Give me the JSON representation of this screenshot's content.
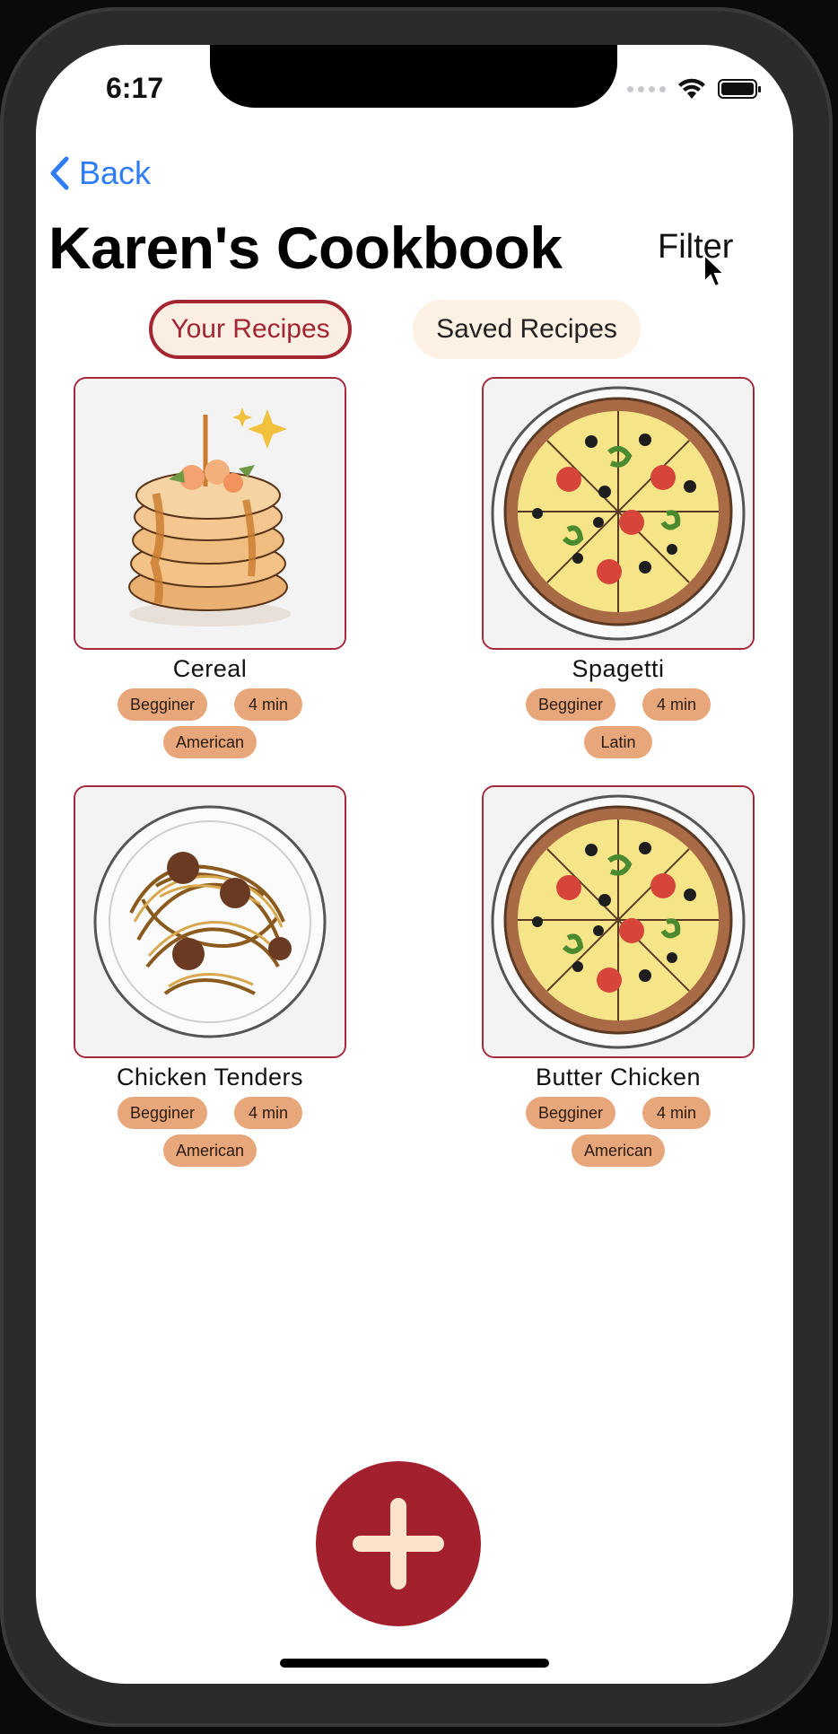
{
  "status_bar": {
    "time": "6:17"
  },
  "nav": {
    "back_label": "Back"
  },
  "header": {
    "title": "Karen's Cookbook",
    "filter_label": "Filter"
  },
  "tabs": {
    "your_recipes": "Your Recipes",
    "saved_recipes": "Saved Recipes",
    "selected": "Your Recipes"
  },
  "recipes": [
    {
      "name": "Cereal",
      "image": "pancakes-illustration",
      "tags": [
        "Begginer",
        "4 min",
        "American"
      ]
    },
    {
      "name": "Spagetti",
      "image": "pizza-illustration",
      "tags": [
        "Begginer",
        "4 min",
        "Latin"
      ]
    },
    {
      "name": "Chicken Tenders",
      "image": "spaghetti-illustration",
      "tags": [
        "Begginer",
        "4 min",
        "American"
      ]
    },
    {
      "name": "Butter Chicken",
      "image": "pizza-illustration",
      "tags": [
        "Begginer",
        "4 min",
        "American"
      ]
    }
  ],
  "add_button": {
    "icon": "plus-icon"
  },
  "colors": {
    "accent": "#a3212e",
    "tag": "#e8a67b",
    "link": "#2f7df6",
    "tab_bg": "#fbeee2"
  }
}
